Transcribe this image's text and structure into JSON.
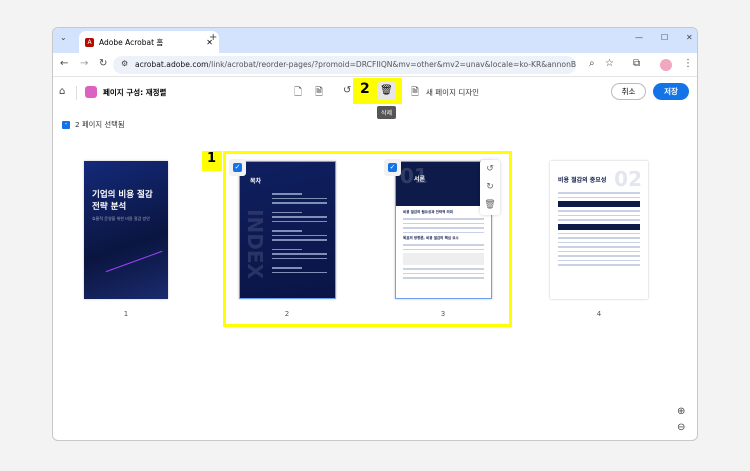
{
  "browser": {
    "tab_title": "Adobe Acrobat 홈",
    "url_domain": "acrobat.adobe.com",
    "url_path": "/link/acrobat/reorder-pages/?promoid=DRCFIIQN&mv=other&mv2=unav&locale=ko-KR&annonBbo..."
  },
  "toolbar": {
    "title": "페이지 구성: 재정렬",
    "new_page_design": "새 페이지 디자인",
    "cancel": "취소",
    "save": "저장",
    "delete_tooltip": "삭제"
  },
  "selection": {
    "text": "2 페이지 선택됨"
  },
  "annotations": {
    "box1": "1",
    "box2": "2"
  },
  "pages": [
    {
      "number": "1",
      "title": "기업의 비용 절감 전략 분석",
      "subtitle": "효율적 운영을 위한 비용 절감 방안"
    },
    {
      "number": "2",
      "title": "목차",
      "watermark": "INDEX"
    },
    {
      "number": "3",
      "title": "서론",
      "watermark": "01",
      "h1": "비용 절감의 필요성과 전략적 의미",
      "h2": "목표의 방향론, 비용 절감의 핵심 요소"
    },
    {
      "number": "4",
      "title": "비용 절감의 중요성",
      "watermark": "02"
    }
  ],
  "colors": {
    "accent": "#1473e6",
    "highlight": "#ffff00",
    "navy": "#0d1a4a"
  }
}
